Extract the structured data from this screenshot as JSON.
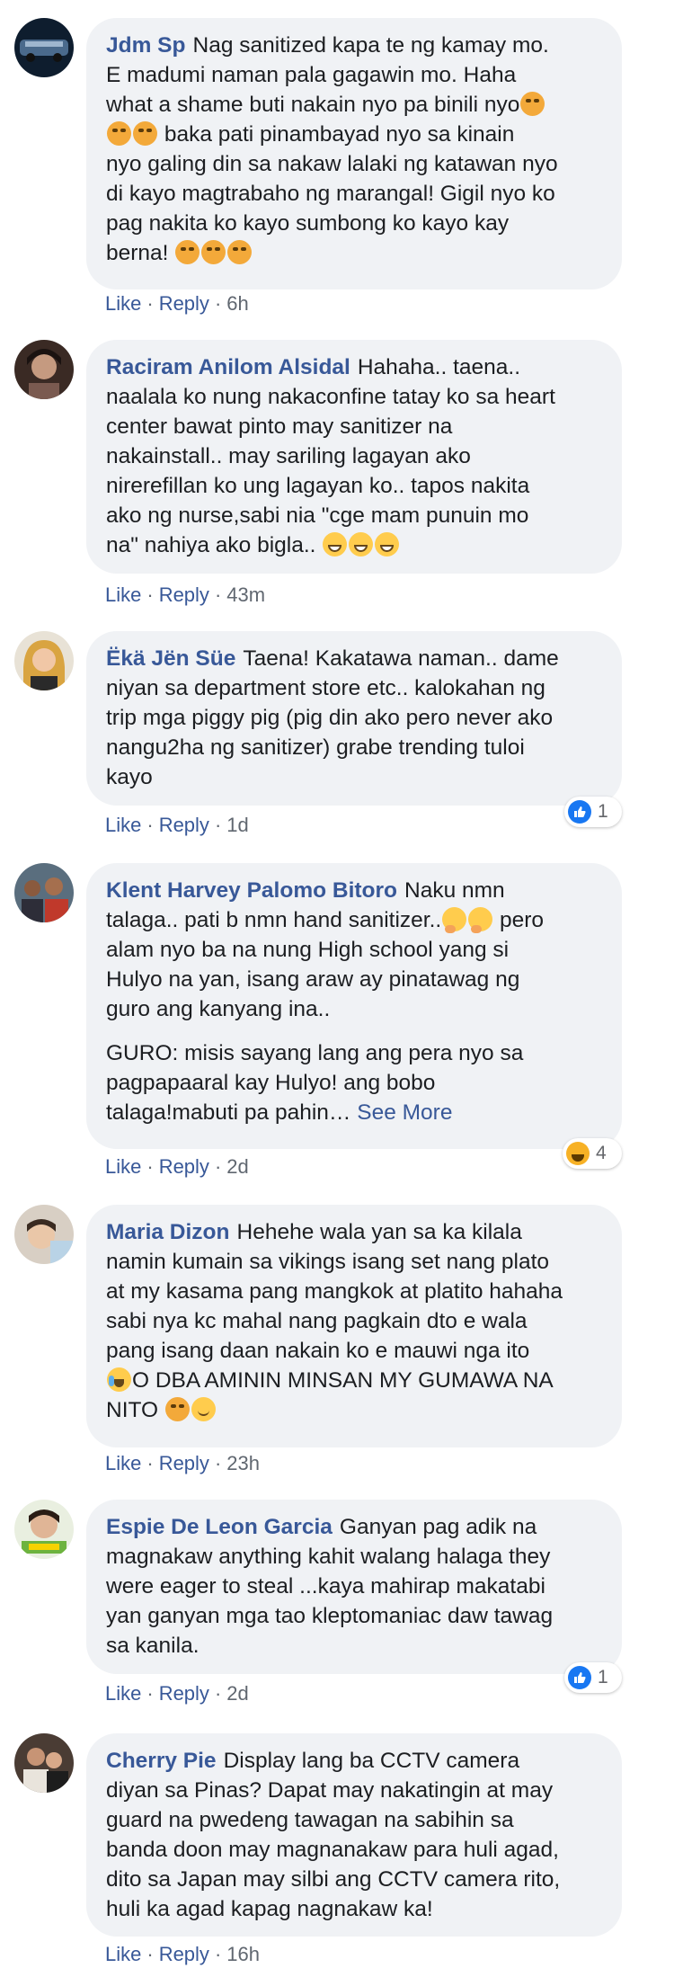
{
  "comments": [
    {
      "name": "Jdm Sp",
      "lines": [
        "Nag sanitized kapa te ng kamay mo.",
        "E madumi naman pala gagawin mo. Haha",
        "what a shame buti nakain nyo pa binili nyo",
        "baka pati pinambayad nyo sa kinain",
        "nyo galing din sa nakaw lalaki ng katawan nyo",
        "di kayo magtrabaho ng marangal! Gigil nyo ko",
        "pag nakita ko kayo sumbong ko kayo kay",
        "berna!"
      ],
      "like": "Like",
      "reply": "Reply",
      "time": "6h"
    },
    {
      "name": "Raciram Anilom Alsidal",
      "lines": [
        "Hahaha.. taena..",
        "naalala ko nung nakaconfine tatay ko sa heart",
        "center bawat pinto may sanitizer na",
        "nakainstall.. may sariling lagayan ako",
        "nirerefillan ko ung lagayan ko.. tapos nakita",
        "ako ng nurse,sabi nia \"cge mam punuin mo",
        "na\" nahiya ako bigla.."
      ],
      "like": "Like",
      "reply": "Reply",
      "time": "43m"
    },
    {
      "name": "Ëkä Jën Süe",
      "lines": [
        "Taena! Kakatawa naman.. dame",
        "niyan sa department store etc.. kalokahan ng",
        "trip mga piggy pig (pig din ako pero never ako",
        "nangu2ha ng sanitizer) grabe trending tuloi",
        "kayo"
      ],
      "like": "Like",
      "reply": "Reply",
      "time": "1d",
      "reaction_count": "1"
    },
    {
      "name": "Klent Harvey Palomo Bitoro",
      "lines": [
        "Naku nmn",
        "talaga.. pati b nmn hand sanitizer..",
        "pero",
        "alam nyo ba na nung High school yang si",
        "Hulyo na yan, isang araw ay pinatawag ng",
        "guro ang kanyang ina.."
      ],
      "lines2": [
        "GURO: misis sayang lang ang pera nyo sa",
        "pagpapaaral kay Hulyo! ang bobo",
        "talaga!mabuti pa pahin…"
      ],
      "see_more": "See More",
      "like": "Like",
      "reply": "Reply",
      "time": "2d",
      "reaction_count": "4"
    },
    {
      "name": "Maria Dizon",
      "lines": [
        "Hehehe wala yan sa ka kilala",
        "namin kumain sa vikings isang set nang plato",
        "at my kasama pang mangkok at platito hahaha",
        "sabi nya kc mahal nang pagkain dto e wala",
        "pang isang daan nakain ko e mauwi nga ito",
        "O DBA AMININ MINSAN MY GUMAWA NA",
        "NITO"
      ],
      "like": "Like",
      "reply": "Reply",
      "time": "23h"
    },
    {
      "name": "Espie De Leon Garcia",
      "lines": [
        "Ganyan pag adik na",
        "magnakaw anything kahit walang halaga they",
        "were eager to steal ...kaya mahirap makatabi",
        "yan ganyan mga tao kleptomaniac daw tawag",
        "sa kanila."
      ],
      "like": "Like",
      "reply": "Reply",
      "time": "2d",
      "reaction_count": "1"
    },
    {
      "name": "Cherry Pie",
      "lines": [
        "Display lang ba CCTV camera",
        "diyan sa Pinas? Dapat may nakatingin at may",
        "guard na pwedeng tawagan na sabihin sa",
        "banda doon may magnanakaw para huli agad,",
        "dito sa Japan may silbi ang CCTV camera rito,",
        "huli ka agad kapag nagnakaw ka!"
      ],
      "like": "Like",
      "reply": "Reply",
      "time": "16h"
    }
  ],
  "colors": {
    "name": "#385898",
    "bubble": "#f0f2f5",
    "meta": "#606770",
    "like_blue": "#1877f2"
  },
  "icons": {
    "emoji_1": "tired-face-emoji",
    "emoji_2": "grinning-face-emoji",
    "emoji_3": "thinking-face-emoji",
    "emoji_4": "laughing-face-emoji",
    "emoji_5": "smiling-face-emoji",
    "reaction_like": "like-reaction-icon",
    "reaction_haha": "haha-reaction-icon"
  }
}
